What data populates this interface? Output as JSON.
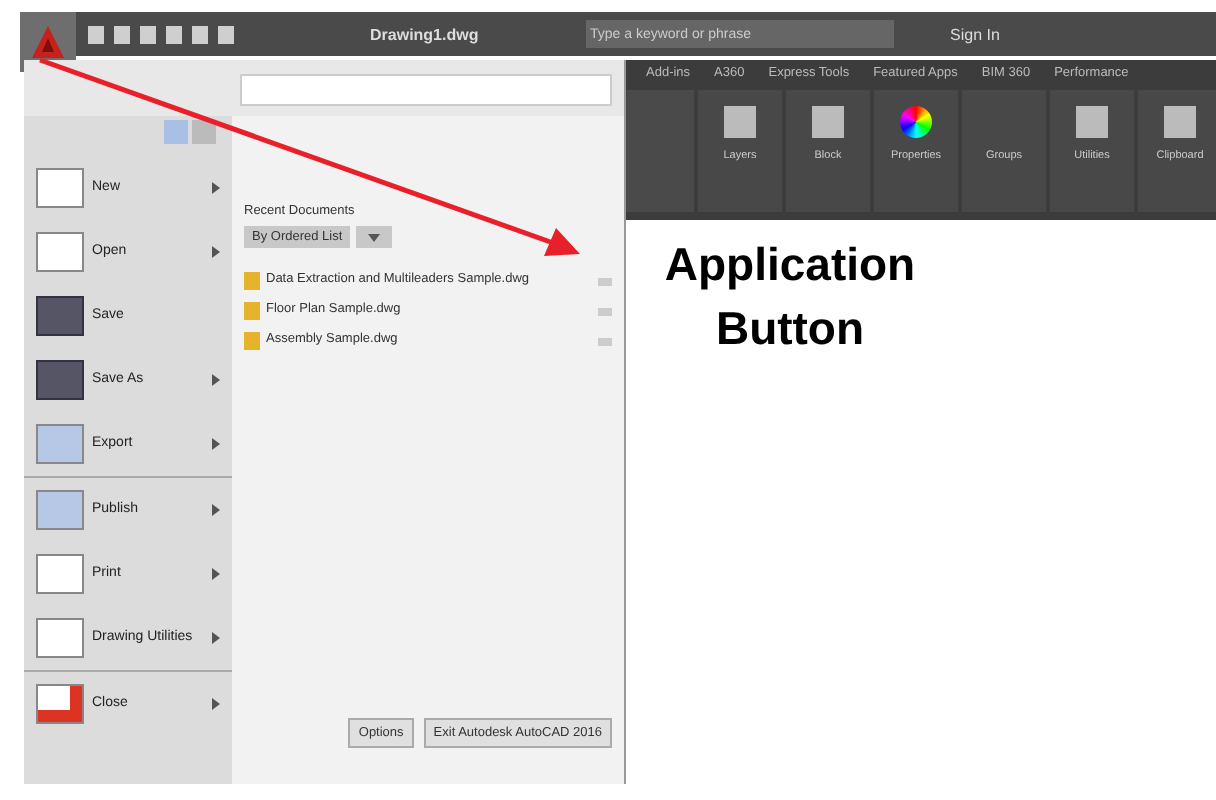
{
  "title_bar": {
    "document_title": "Drawing1.dwg",
    "search": {
      "placeholder": "Type a keyword or phrase"
    },
    "sign_in": "Sign In"
  },
  "ribbon": {
    "tabs": [
      {
        "label": "Add-ins",
        "selected": false
      },
      {
        "label": "A360",
        "selected": false
      },
      {
        "label": "Express Tools",
        "selected": false
      },
      {
        "label": "Featured Apps",
        "selected": false
      },
      {
        "label": "BIM 360",
        "selected": false
      },
      {
        "label": "Performance",
        "selected": false
      }
    ],
    "panels": [
      {
        "kind": "layers",
        "label": "Layers"
      },
      {
        "kind": "block",
        "label": "Block"
      },
      {
        "kind": "properties",
        "label": "Properties"
      },
      {
        "kind": "groups",
        "label": "Groups"
      },
      {
        "kind": "utilities",
        "label": "Utilities"
      },
      {
        "kind": "clipboard",
        "label": "Clipboard"
      }
    ]
  },
  "app_menu": {
    "commands": [
      {
        "kind": "new",
        "label": "New",
        "submenu": true
      },
      {
        "kind": "open",
        "label": "Open",
        "submenu": true
      },
      {
        "kind": "save",
        "label": "Save",
        "submenu": false
      },
      {
        "kind": "saveas",
        "label": "Save As",
        "submenu": true
      },
      {
        "kind": "export",
        "label": "Export",
        "submenu": true
      },
      {
        "kind": "publish",
        "label": "Publish",
        "submenu": true
      },
      {
        "kind": "print",
        "label": "Print",
        "submenu": true
      },
      {
        "kind": "utilities",
        "label": "Drawing Utilities",
        "submenu": true
      },
      {
        "kind": "close",
        "label": "Close",
        "submenu": true
      }
    ],
    "recent_heading": "Recent Documents",
    "sort": "By Ordered List",
    "recent": [
      {
        "name": "Data Extraction and Multileaders Sample.dwg"
      },
      {
        "name": "Floor Plan Sample.dwg"
      },
      {
        "name": "Assembly Sample.dwg"
      }
    ],
    "buttons": [
      "Options",
      "Exit Autodesk AutoCAD 2016"
    ]
  },
  "callout": "Application Button"
}
